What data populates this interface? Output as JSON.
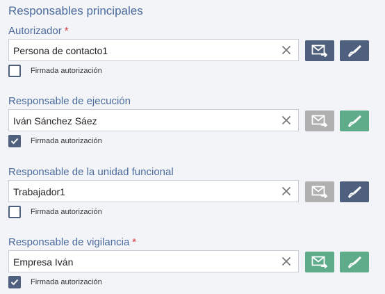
{
  "section_title": "Responsables principales",
  "colors": {
    "title_blue": "#4a6a9c",
    "required_red": "#d9343e",
    "active_dark": "#4f607e",
    "active_green": "#5fac8b",
    "disabled_gray": "#b0b0b0"
  },
  "checkbox_label": "Firmada autorización",
  "groups": [
    {
      "label": "Autorizador",
      "required_mark": "*",
      "value": "Persona de contacto1",
      "mail_state": "dark",
      "sign_state": "dark",
      "signed": false
    },
    {
      "label": "Responsable de ejecución",
      "required_mark": "",
      "value": "Iván Sánchez Sáez",
      "mail_state": "disabled",
      "sign_state": "green",
      "signed": true
    },
    {
      "label": "Responsable de la unidad funcional",
      "required_mark": "",
      "value": "Trabajador1",
      "mail_state": "disabled",
      "sign_state": "dark",
      "signed": false
    },
    {
      "label": "Responsable de vigilancia",
      "required_mark": "*",
      "value": "Empresa Iván",
      "mail_state": "green",
      "sign_state": "green",
      "signed": true
    }
  ],
  "icons": {
    "clear": "close-icon",
    "mail": "mail-send-icon",
    "sign": "signature-pen-icon",
    "check": "checkmark-icon"
  }
}
